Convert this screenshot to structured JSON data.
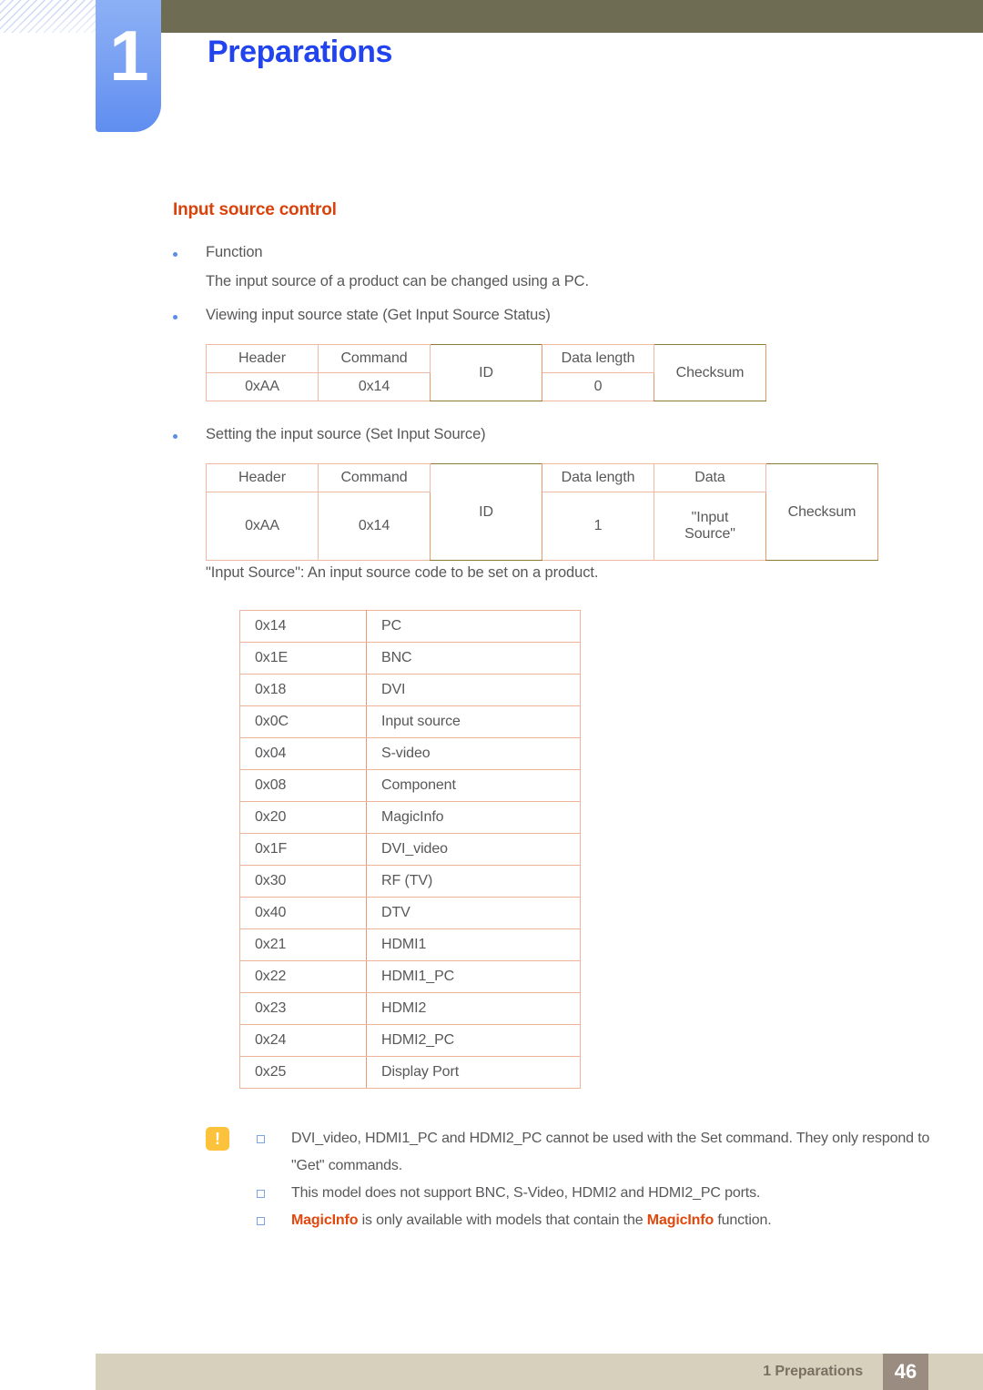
{
  "header": {
    "chapter_number": "1",
    "chapter_title": "Preparations"
  },
  "section": {
    "title": "Input source control"
  },
  "bullets": {
    "function_label": "Function",
    "function_desc": "The input source of a product can be changed using a PC.",
    "viewing_label": "Viewing input source state (Get Input Source Status)",
    "setting_label": "Setting the input source (Set Input Source)",
    "input_source_note": "\"Input Source\": An input source code to be set on a product."
  },
  "get_table": {
    "headers": [
      "Header",
      "Command",
      "ID",
      "Data length",
      "Checksum"
    ],
    "values": [
      "0xAA",
      "0x14",
      "",
      "0",
      ""
    ]
  },
  "set_table": {
    "headers": [
      "Header",
      "Command",
      "ID",
      "Data length",
      "Data",
      "Checksum"
    ],
    "values": [
      "0xAA",
      "0x14",
      "ID",
      "1",
      "\"Input Source\"",
      "Checksum"
    ],
    "id_label": "ID",
    "data_value_line1": "\"Input",
    "data_value_line2": "Source\"",
    "checksum_label": "Checksum"
  },
  "source_codes": [
    {
      "code": "0x14",
      "name": "PC"
    },
    {
      "code": "0x1E",
      "name": "BNC"
    },
    {
      "code": "0x18",
      "name": "DVI"
    },
    {
      "code": "0x0C",
      "name": "Input source"
    },
    {
      "code": "0x04",
      "name": "S-video"
    },
    {
      "code": "0x08",
      "name": "Component"
    },
    {
      "code": "0x20",
      "name": "MagicInfo"
    },
    {
      "code": "0x1F",
      "name": "DVI_video"
    },
    {
      "code": "0x30",
      "name": "RF (TV)"
    },
    {
      "code": "0x40",
      "name": "DTV"
    },
    {
      "code": "0x21",
      "name": "HDMI1"
    },
    {
      "code": "0x22",
      "name": "HDMI1_PC"
    },
    {
      "code": "0x23",
      "name": "HDMI2"
    },
    {
      "code": "0x24",
      "name": "HDMI2_PC"
    },
    {
      "code": "0x25",
      "name": "Display Port"
    }
  ],
  "notes": {
    "icon_mark": "!",
    "items": [
      "DVI_video, HDMI1_PC and HDMI2_PC cannot be used with the Set command. They only respond to \"Get\" commands.",
      "This model does not support BNC, S-Video, HDMI2 and HDMI2_PC ports."
    ],
    "magicinfo_line": {
      "term": "MagicInfo",
      "mid": " is only available with models that contain the ",
      "term2": "MagicInfo",
      "tail": " function."
    }
  },
  "footer": {
    "label": "1 Preparations",
    "page": "46"
  },
  "colors": {
    "olive_bar": "#6f6c54",
    "chapter_blue": "#2244ee",
    "section_orange": "#d9420b",
    "table_border": "#8a7c33",
    "table_inner": "#efb9a3",
    "note_icon": "#fcc23c",
    "footer_bar": "#d6d0bd",
    "footer_page": "#9a8c80"
  }
}
